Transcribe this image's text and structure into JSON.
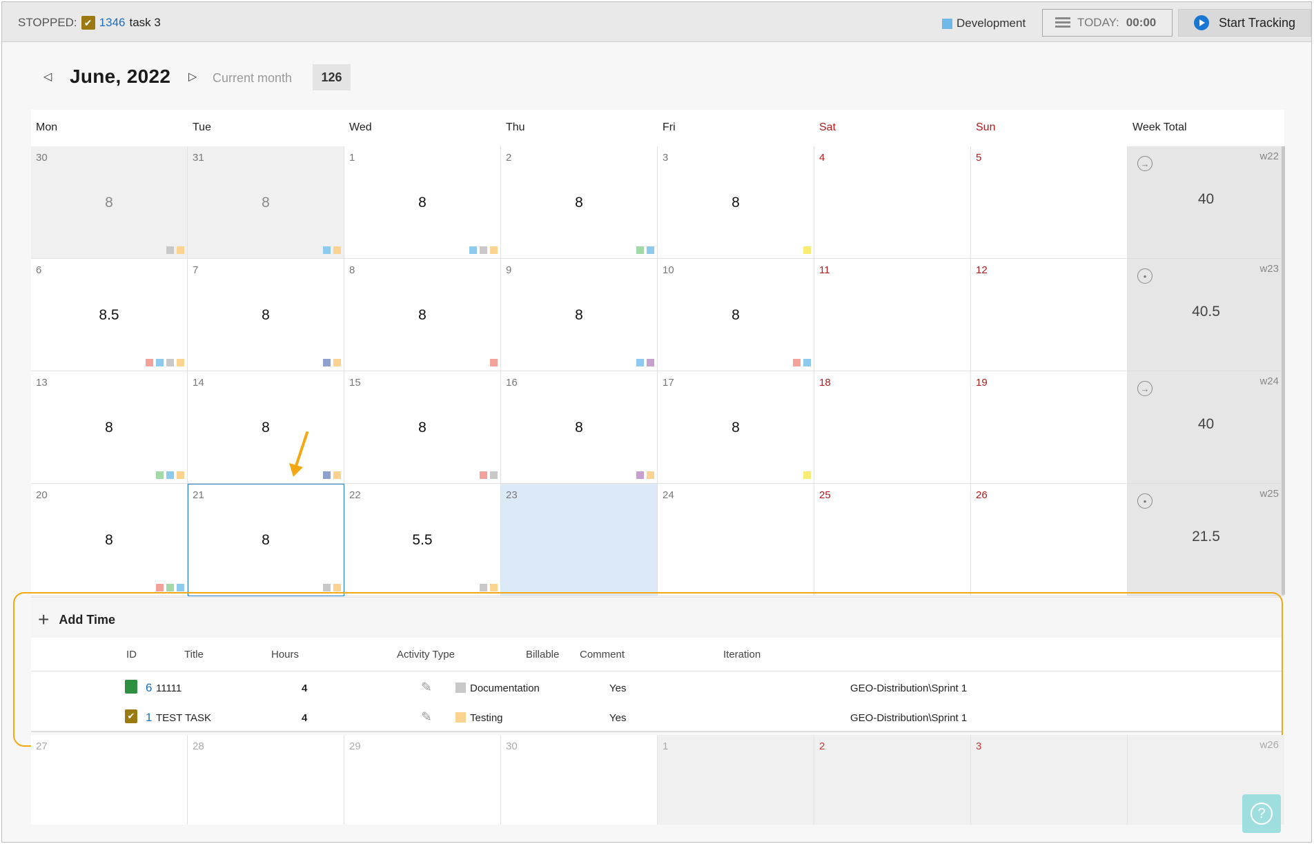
{
  "topbar": {
    "status_label": "STOPPED:",
    "task_id": "1346",
    "task_name": "task 3",
    "activity_label": "Development",
    "activity_color": "#6fb8e8",
    "today_label": "TODAY:",
    "today_value": "00:00",
    "start_label": "Start Tracking"
  },
  "month": {
    "title": "June, 2022",
    "current_label": "Current month",
    "total": "126"
  },
  "headers": [
    "Mon",
    "Tue",
    "Wed",
    "Thu",
    "Fri",
    "Sat",
    "Sun",
    "Week Total"
  ],
  "weeks": [
    {
      "week": "w22",
      "total": "40",
      "icon": "→",
      "days": [
        {
          "num": "30",
          "hours": "8",
          "out": true,
          "dots": [
            "#c8c8c8",
            "#f9d38f"
          ]
        },
        {
          "num": "31",
          "hours": "8",
          "out": true,
          "dots": [
            "#8ec9ee",
            "#f9d38f"
          ]
        },
        {
          "num": "1",
          "hours": "8",
          "dots": [
            "#8ec9ee",
            "#c8c8c8",
            "#f9d38f"
          ]
        },
        {
          "num": "2",
          "hours": "8",
          "dots": [
            "#a3d9a6",
            "#8ec9ee"
          ]
        },
        {
          "num": "3",
          "hours": "8",
          "dots": [
            "#f8ec75"
          ]
        },
        {
          "num": "4",
          "hours": "",
          "wk": true,
          "dots": []
        },
        {
          "num": "5",
          "hours": "",
          "wk": true,
          "dots": []
        }
      ]
    },
    {
      "week": "w23",
      "total": "40.5",
      "icon": "•",
      "days": [
        {
          "num": "6",
          "hours": "8.5",
          "dots": [
            "#f2a19b",
            "#8ec9ee",
            "#c8c8c8",
            "#f9d38f"
          ]
        },
        {
          "num": "7",
          "hours": "8",
          "dots": [
            "#8fa0cf",
            "#f9d38f"
          ]
        },
        {
          "num": "8",
          "hours": "8",
          "dots": [
            "#f2a19b"
          ]
        },
        {
          "num": "9",
          "hours": "8",
          "dots": [
            "#8ec9ee",
            "#c6a1cf"
          ]
        },
        {
          "num": "10",
          "hours": "8",
          "dots": [
            "#f2a19b",
            "#8ec9ee"
          ]
        },
        {
          "num": "11",
          "hours": "",
          "wk": true,
          "dots": []
        },
        {
          "num": "12",
          "hours": "",
          "wk": true,
          "dots": []
        }
      ]
    },
    {
      "week": "w24",
      "total": "40",
      "icon": "→",
      "days": [
        {
          "num": "13",
          "hours": "8",
          "dots": [
            "#a3d9a6",
            "#8ec9ee",
            "#f9d38f"
          ]
        },
        {
          "num": "14",
          "hours": "8",
          "dots": [
            "#8fa0cf",
            "#f9d38f"
          ]
        },
        {
          "num": "15",
          "hours": "8",
          "dots": [
            "#f2a19b",
            "#c8c8c8"
          ]
        },
        {
          "num": "16",
          "hours": "8",
          "dots": [
            "#c6a1cf",
            "#f9d38f"
          ]
        },
        {
          "num": "17",
          "hours": "8",
          "dots": [
            "#f8ec75"
          ]
        },
        {
          "num": "18",
          "hours": "",
          "wk": true,
          "dots": []
        },
        {
          "num": "19",
          "hours": "",
          "wk": true,
          "dots": []
        }
      ]
    },
    {
      "week": "w25",
      "total": "21.5",
      "icon": "•",
      "days": [
        {
          "num": "20",
          "hours": "8",
          "dots": [
            "#f2a19b",
            "#a3d9a6",
            "#8ec9ee"
          ]
        },
        {
          "num": "21",
          "hours": "8",
          "selected": true,
          "dots": [
            "#c8c8c8",
            "#f9d38f"
          ]
        },
        {
          "num": "22",
          "hours": "5.5",
          "dots": [
            "#c8c8c8",
            "#f9d38f"
          ]
        },
        {
          "num": "23",
          "hours": "",
          "today": true,
          "dots": []
        },
        {
          "num": "24",
          "hours": "",
          "dots": []
        },
        {
          "num": "25",
          "hours": "",
          "wk": true,
          "dots": []
        },
        {
          "num": "26",
          "hours": "",
          "wk": true,
          "dots": []
        }
      ]
    }
  ],
  "detail": {
    "add_label": "Add Time",
    "columns": [
      "ID",
      "Title",
      "Hours",
      "Activity Type",
      "Billable",
      "Comment",
      "Iteration"
    ],
    "rows": [
      {
        "id": "6",
        "title": "11111",
        "hours": "4",
        "activity": "Documentation",
        "activity_color": "#c8c8c8",
        "billable": "Yes",
        "comment": "",
        "iteration": "GEO-Distribution\\Sprint 1",
        "icon": "green"
      },
      {
        "id": "1",
        "title": "TEST TASK",
        "hours": "4",
        "activity": "Testing",
        "activity_color": "#f9d38f",
        "billable": "Yes",
        "comment": "",
        "iteration": "GEO-Distribution\\Sprint 1",
        "icon": "task"
      }
    ]
  },
  "next_week": {
    "week": "w26",
    "days": [
      {
        "num": "27"
      },
      {
        "num": "28"
      },
      {
        "num": "29"
      },
      {
        "num": "30"
      },
      {
        "num": "1",
        "out": true
      },
      {
        "num": "2",
        "out": true,
        "wk": true
      },
      {
        "num": "3",
        "out": true,
        "wk": true
      }
    ]
  },
  "help_label": "?"
}
